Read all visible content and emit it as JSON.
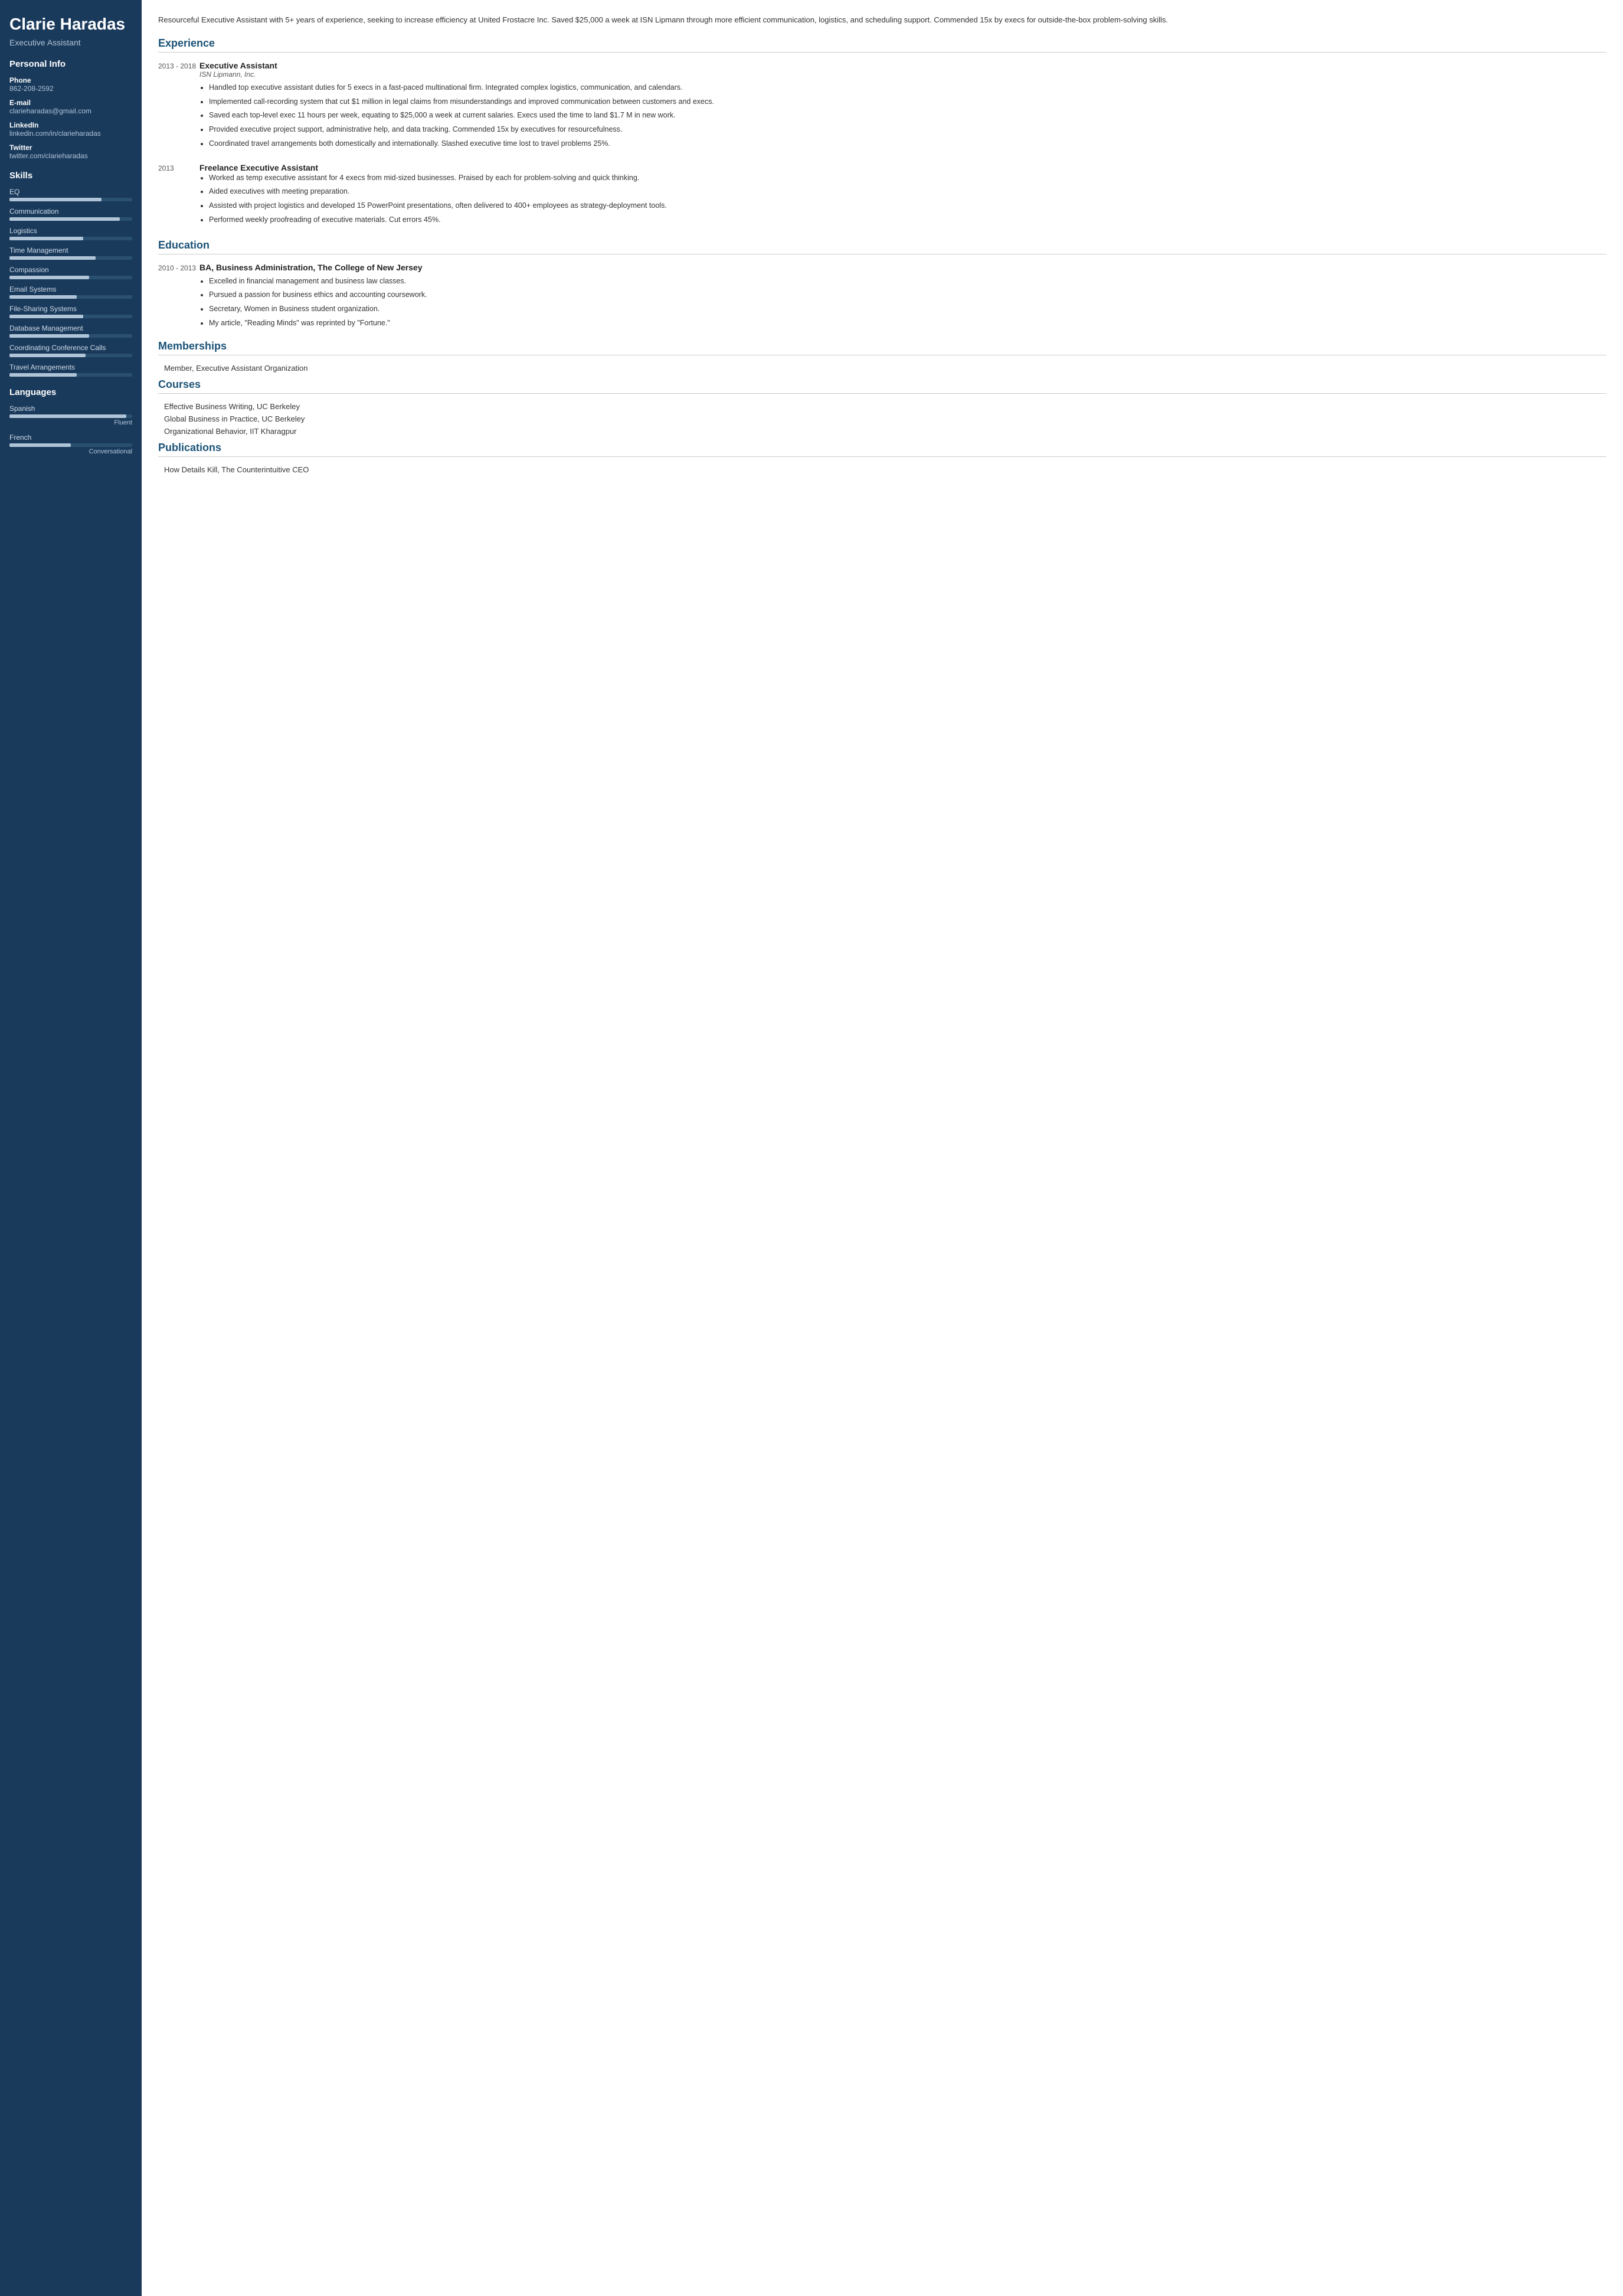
{
  "sidebar": {
    "name": "Clarie Haradas",
    "title": "Executive Assistant",
    "personal_info_label": "Personal Info",
    "phone_label": "Phone",
    "phone": "862-208-2592",
    "email_label": "E-mail",
    "email": "clarieharadas@gmail.com",
    "linkedin_label": "LinkedIn",
    "linkedin": "linkedin.com/in/clarieharadas",
    "twitter_label": "Twitter",
    "twitter": "twitter.com/clarieharadas",
    "skills_label": "Skills",
    "skills": [
      {
        "name": "EQ",
        "pct": 75
      },
      {
        "name": "Communication",
        "pct": 90
      },
      {
        "name": "Logistics",
        "pct": 60
      },
      {
        "name": "Time Management",
        "pct": 70
      },
      {
        "name": "Compassion",
        "pct": 65
      },
      {
        "name": "Email Systems",
        "pct": 55
      },
      {
        "name": "File-Sharing Systems",
        "pct": 60
      },
      {
        "name": "Database Management",
        "pct": 65
      },
      {
        "name": "Coordinating Conference Calls",
        "pct": 62
      },
      {
        "name": "Travel Arrangements",
        "pct": 55
      }
    ],
    "languages_label": "Languages",
    "languages": [
      {
        "name": "Spanish",
        "pct": 95,
        "level": "Fluent"
      },
      {
        "name": "French",
        "pct": 50,
        "level": "Conversational"
      }
    ]
  },
  "main": {
    "summary": "Resourceful Executive Assistant with 5+ years of experience, seeking to increase efficiency at United Frostacre Inc. Saved $25,000 a week at ISN Lipmann through more efficient communication, logistics, and scheduling support. Commended 15x by execs for outside-the-box problem-solving skills.",
    "experience_label": "Experience",
    "experiences": [
      {
        "date": "2013 - 2018",
        "title": "Executive Assistant",
        "company": "ISN Lipmann, Inc.",
        "bullets": [
          "Handled top executive assistant duties for 5 execs in a fast-paced multinational firm. Integrated complex logistics, communication, and calendars.",
          "Implemented call-recording system that cut $1 million in legal claims from misunderstandings and improved communication between customers and execs.",
          "Saved each top-level exec 11 hours per week, equating to $25,000 a week at current salaries. Execs used the time to land $1.7 M in new work.",
          "Provided executive project support, administrative help, and data tracking. Commended 15x by executives for resourcefulness.",
          "Coordinated travel arrangements both domestically and internationally. Slashed executive time lost to travel problems 25%."
        ]
      },
      {
        "date": "2013",
        "title": "Freelance Executive Assistant",
        "company": "",
        "bullets": [
          "Worked as temp executive assistant for 4 execs from mid-sized businesses. Praised by each for problem-solving and quick thinking.",
          "Aided executives with meeting preparation.",
          "Assisted with project logistics and developed 15 PowerPoint presentations, often delivered to 400+ employees as strategy-deployment tools.",
          "Performed weekly proofreading of executive materials. Cut errors 45%."
        ]
      }
    ],
    "education_label": "Education",
    "educations": [
      {
        "date": "2010 - 2013",
        "title": "BA, Business Administration, The College of New Jersey",
        "bullets": [
          "Excelled in financial management and business law classes.",
          "Pursued a passion for business ethics and accounting coursework.",
          "Secretary, Women in Business student organization.",
          "My article, \"Reading Minds\" was reprinted by \"Fortune.\""
        ]
      }
    ],
    "memberships_label": "Memberships",
    "memberships": [
      "Member, Executive Assistant Organization"
    ],
    "courses_label": "Courses",
    "courses": [
      "Effective Business Writing, UC Berkeley",
      "Global Business in Practice, UC Berkeley",
      "Organizational Behavior, IIT Kharagpur"
    ],
    "publications_label": "Publications",
    "publications": [
      "How Details Kill, The Counterintuitive CEO"
    ]
  }
}
